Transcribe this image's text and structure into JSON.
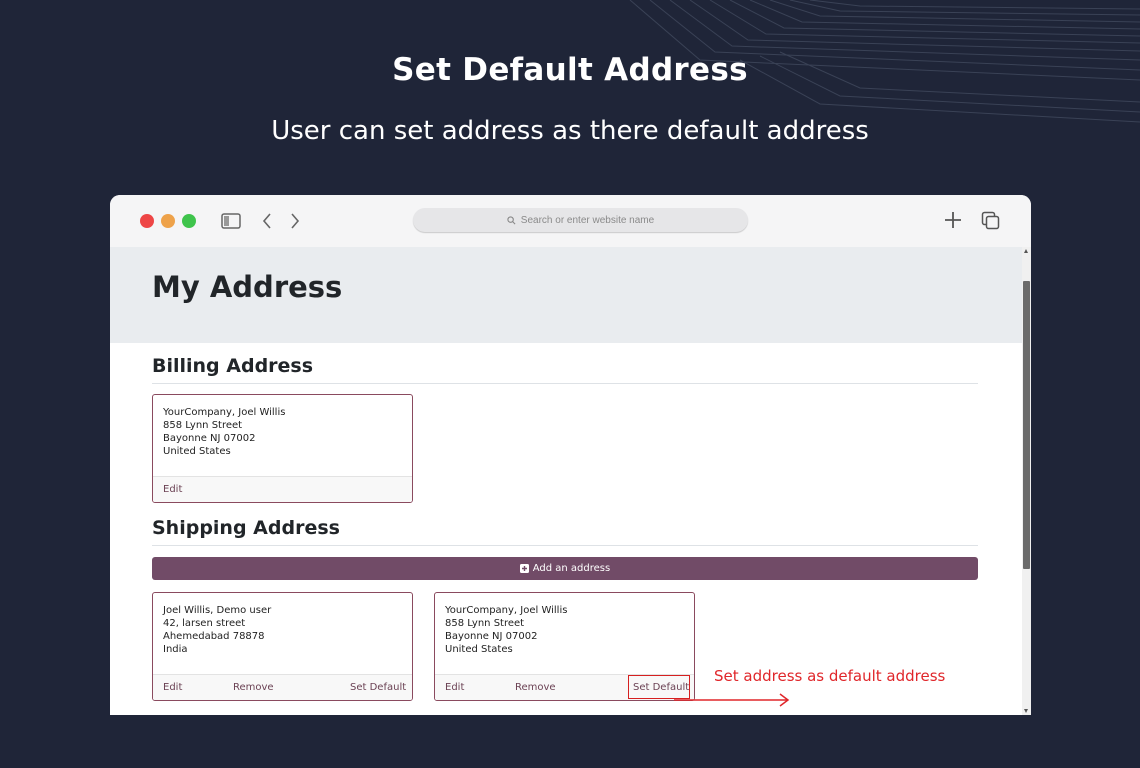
{
  "hero": {
    "title": "Set Default Address",
    "subtitle": "User can set address as there default address"
  },
  "browser": {
    "search_placeholder": "Search or enter website name",
    "icons": [
      "sidebar-icon",
      "back-chevron-icon",
      "forward-chevron-icon",
      "new-tab-plus-icon",
      "tabs-overview-icon"
    ]
  },
  "page": {
    "title": "My Address",
    "billing": {
      "heading": "Billing Address",
      "card": {
        "lines": [
          "YourCompany, Joel Willis",
          "858 Lynn Street",
          "Bayonne NJ 07002",
          "United States"
        ],
        "edit_label": "Edit"
      }
    },
    "shipping": {
      "heading": "Shipping Address",
      "add_label": "Add an address",
      "cards": [
        {
          "lines": [
            "Joel Willis, Demo user",
            "42, larsen street",
            "Ahemedabad 78878",
            "India"
          ],
          "edit_label": "Edit",
          "remove_label": "Remove",
          "set_default_label": "Set Default"
        },
        {
          "lines": [
            "YourCompany, Joel Willis",
            "858 Lynn Street",
            "Bayonne NJ 07002",
            "United States"
          ],
          "edit_label": "Edit",
          "remove_label": "Remove",
          "set_default_label": "Set Default"
        }
      ]
    }
  },
  "annotation": {
    "text": "Set address as default address",
    "color": "#e0262a"
  },
  "colors": {
    "background": "#1f2538",
    "primary_button": "#714b67",
    "card_border": "#8a4a5e"
  }
}
